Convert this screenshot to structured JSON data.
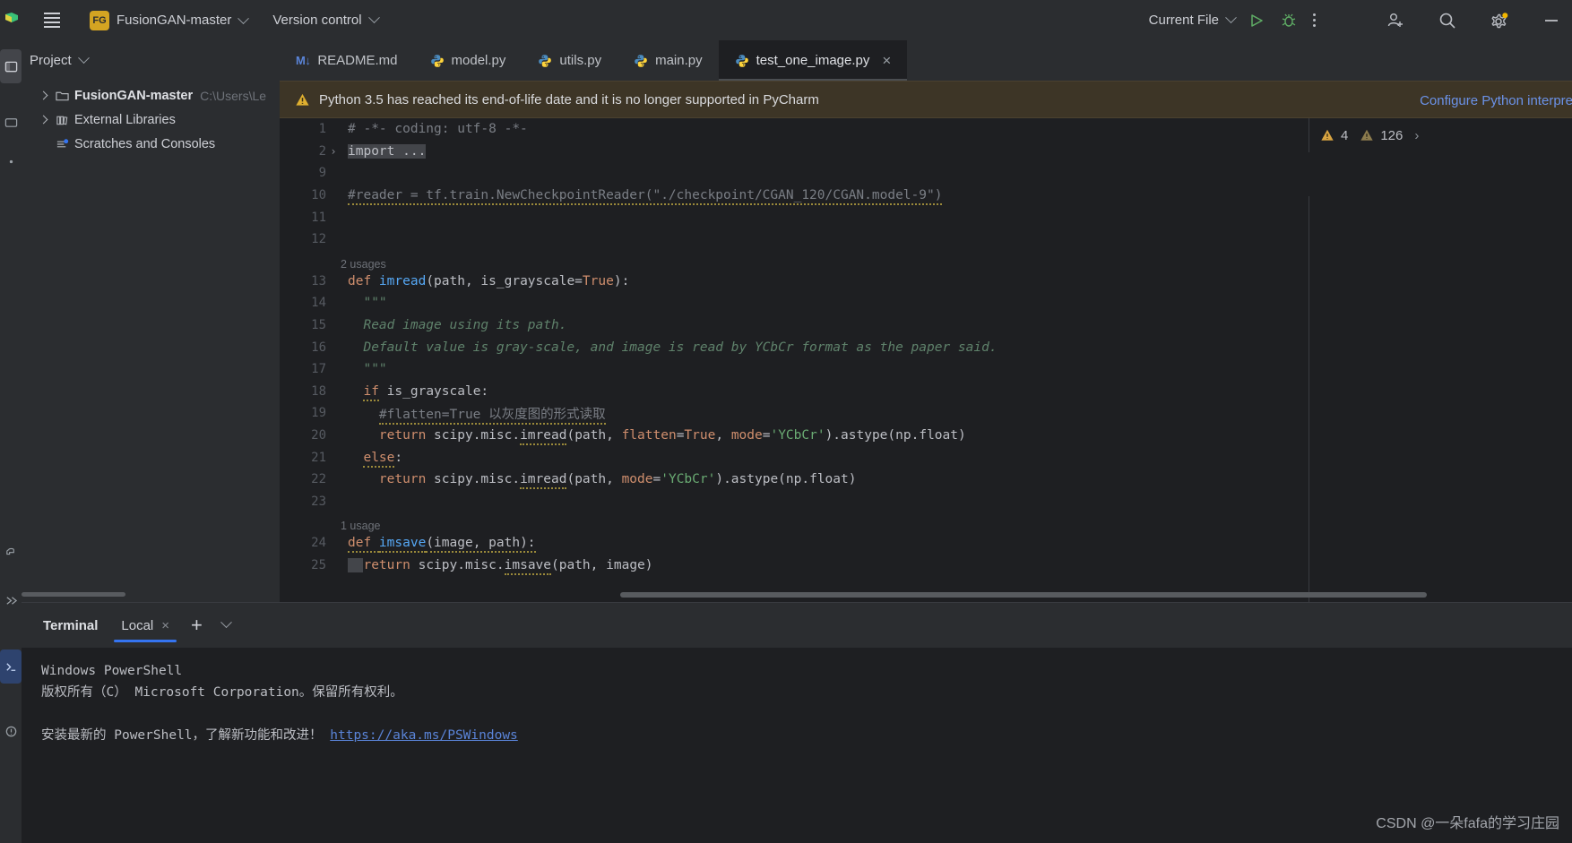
{
  "titlebar": {
    "menu_icon": "hamburger-icon",
    "project_badge": "FG",
    "project_name": "FusionGAN-master",
    "version_control": "Version control",
    "run_config": "Current File",
    "run_icon": "run-triangle-icon",
    "debug_icon": "debug-bug-icon",
    "more_icon": "kebab-menu-icon",
    "add_user_icon": "add-user-icon",
    "search_icon": "search-icon",
    "settings_icon": "gear-icon",
    "minimize_icon": "minimize-icon",
    "accent_run_green": "#5fad65",
    "badge_yellow": "#d4a422",
    "settings_dot": "#d4a422"
  },
  "project_panel": {
    "title": "Project",
    "items": [
      {
        "label": "FusionGAN-master",
        "path": "C:\\Users\\Le",
        "icon": "folder-icon",
        "expandable": true,
        "bold": true
      },
      {
        "label": "External Libraries",
        "path": "",
        "icon": "library-icon",
        "expandable": true,
        "bold": false
      },
      {
        "label": "Scratches and Consoles",
        "path": "",
        "icon": "scratches-icon",
        "expandable": false,
        "bold": false
      }
    ]
  },
  "editor": {
    "tabs": [
      {
        "label": "README.md",
        "icon": "markdown-icon",
        "active": false,
        "closable": false
      },
      {
        "label": "model.py",
        "icon": "python-icon",
        "active": false,
        "closable": false
      },
      {
        "label": "utils.py",
        "icon": "python-icon",
        "active": false,
        "closable": false
      },
      {
        "label": "main.py",
        "icon": "python-icon",
        "active": false,
        "closable": false
      },
      {
        "label": "test_one_image.py",
        "icon": "python-icon",
        "active": true,
        "closable": true
      }
    ],
    "notification": {
      "icon": "warning-triangle-icon",
      "text": "Python 3.5 has reached its end-of-life date and it is no longer supported in PyCharm",
      "link": "Configure Python interpre"
    },
    "inspection": {
      "warning_icon": "warning-triangle-icon",
      "warning_count": "4",
      "weak_warning_icon": "warning-triangle-icon",
      "weak_warning_count": "126"
    },
    "lines": [
      {
        "num": "1",
        "tokens": [
          {
            "t": "# -*- coding: utf-8 -*-",
            "c": "cm"
          }
        ]
      },
      {
        "num": "2",
        "fold": "›",
        "tokens": [
          {
            "t": "import ...",
            "c": "pl hl-import"
          }
        ]
      },
      {
        "num": "9",
        "tokens": []
      },
      {
        "num": "10",
        "tokens": [
          {
            "t": "#reader = tf.train.NewCheckpointReader(\"./checkpoint/CGAN_120/CGAN.model-9\")",
            "c": "cm wavy"
          }
        ]
      },
      {
        "num": "11",
        "tokens": []
      },
      {
        "num": "12",
        "tokens": []
      },
      {
        "num": "13",
        "hint": "2 usages",
        "tokens": [
          {
            "t": "def ",
            "c": "k"
          },
          {
            "t": "imread",
            "c": "fn"
          },
          {
            "t": "(path, is_grayscale=",
            "c": "pl"
          },
          {
            "t": "True",
            "c": "k"
          },
          {
            "t": "):",
            "c": "pl"
          }
        ]
      },
      {
        "num": "14",
        "tokens": [
          {
            "t": "  \"\"\"",
            "c": "doc"
          }
        ]
      },
      {
        "num": "15",
        "tokens": [
          {
            "t": "  Read image using its path.",
            "c": "doc"
          }
        ]
      },
      {
        "num": "16",
        "tokens": [
          {
            "t": "  Default value is gray-scale, and image is read by YCbCr format as the paper said.",
            "c": "doc"
          }
        ]
      },
      {
        "num": "17",
        "tokens": [
          {
            "t": "  \"\"\"",
            "c": "doc"
          }
        ]
      },
      {
        "num": "18",
        "tokens": [
          {
            "t": "  ",
            "c": "pl"
          },
          {
            "t": "if",
            "c": "k wavy"
          },
          {
            "t": " is_grayscale:",
            "c": "pl"
          }
        ]
      },
      {
        "num": "19",
        "tokens": [
          {
            "t": "    ",
            "c": "pl"
          },
          {
            "t": "#flatten=True 以灰度图的形式读取",
            "c": "cm wavy"
          }
        ]
      },
      {
        "num": "20",
        "tokens": [
          {
            "t": "    ",
            "c": "pl"
          },
          {
            "t": "return",
            "c": "k"
          },
          {
            "t": " scipy.misc.",
            "c": "pl"
          },
          {
            "t": "imread",
            "c": "pl wavy"
          },
          {
            "t": "(path, ",
            "c": "pl"
          },
          {
            "t": "flatten",
            "c": "na"
          },
          {
            "t": "=",
            "c": "pl"
          },
          {
            "t": "True",
            "c": "k"
          },
          {
            "t": ", ",
            "c": "pl"
          },
          {
            "t": "mode",
            "c": "na"
          },
          {
            "t": "=",
            "c": "pl"
          },
          {
            "t": "'YCbCr'",
            "c": "st"
          },
          {
            "t": ").astype(np.float)",
            "c": "pl"
          }
        ]
      },
      {
        "num": "21",
        "tokens": [
          {
            "t": "  ",
            "c": "pl"
          },
          {
            "t": "else",
            "c": "k wavy"
          },
          {
            "t": ":",
            "c": "pl"
          }
        ]
      },
      {
        "num": "22",
        "tokens": [
          {
            "t": "    ",
            "c": "pl"
          },
          {
            "t": "return",
            "c": "k"
          },
          {
            "t": " scipy.misc.",
            "c": "pl"
          },
          {
            "t": "imread",
            "c": "pl wavy"
          },
          {
            "t": "(path, ",
            "c": "pl"
          },
          {
            "t": "mode",
            "c": "na"
          },
          {
            "t": "=",
            "c": "pl"
          },
          {
            "t": "'YCbCr'",
            "c": "st"
          },
          {
            "t": ").astype(np.float)",
            "c": "pl"
          }
        ]
      },
      {
        "num": "23",
        "tokens": []
      },
      {
        "num": "24",
        "hint": "1 usage",
        "tokens": [
          {
            "t": "def ",
            "c": "k wavy"
          },
          {
            "t": "imsave",
            "c": "fn wavy"
          },
          {
            "t": "(image, path):",
            "c": "pl wavy"
          }
        ]
      },
      {
        "num": "25",
        "tokens": [
          {
            "t": "  ",
            "c": "pl sel-block"
          },
          {
            "t": "return",
            "c": "k"
          },
          {
            "t": " scipy.misc.",
            "c": "pl"
          },
          {
            "t": "imsave",
            "c": "pl wavy"
          },
          {
            "t": "(path, image)",
            "c": "pl"
          }
        ]
      }
    ]
  },
  "terminal": {
    "title": "Terminal",
    "tab_label": "Local",
    "tab_close": "×",
    "add_icon": "plus-icon",
    "options_icon": "chevron-down-icon",
    "lines": [
      {
        "text": "Windows PowerShell",
        "link": false
      },
      {
        "text": "版权所有（C） Microsoft Corporation。保留所有权利。",
        "link": false
      },
      {
        "text": "",
        "link": false
      },
      {
        "text": "安装最新的 PowerShell，了解新功能和改进！ ",
        "link": false,
        "link_text": "https://aka.ms/PSWindows"
      }
    ]
  },
  "watermark": "CSDN @一朵fafa的学习庄园"
}
